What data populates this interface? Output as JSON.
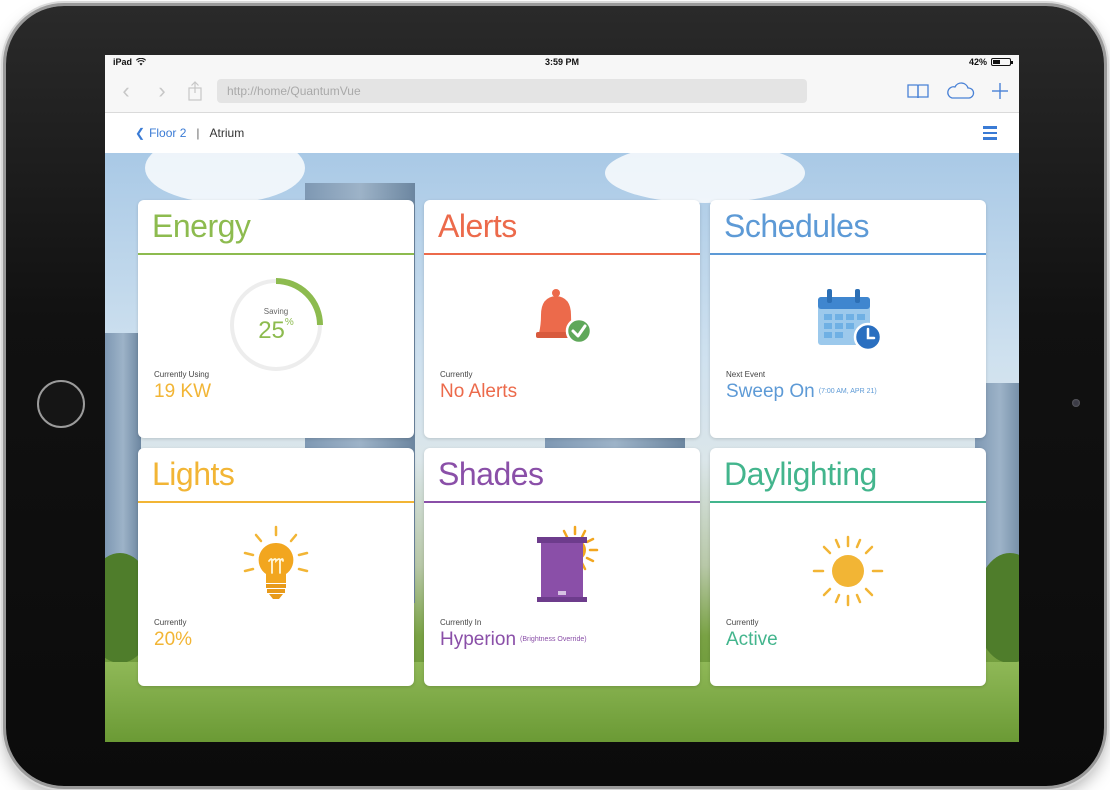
{
  "statusbar": {
    "device": "iPad",
    "time": "3:59 PM",
    "battery": "42%",
    "battery_level": 0.42
  },
  "browser": {
    "url": "http://home/QuantumVue",
    "icons": [
      "back-icon",
      "forward-icon",
      "share-icon",
      "book-icon",
      "cloud-icon",
      "plus-icon"
    ]
  },
  "breadcrumb": {
    "back_label": "Floor 2",
    "separator": "|",
    "current": "Atrium"
  },
  "colors": {
    "energy": "#8dbb4f",
    "alerts": "#ec6a4b",
    "schedules": "#5d9ad6",
    "lights": "#f2b535",
    "shades": "#8a4fa8",
    "daylighting": "#43b58d",
    "link": "#3a7bd5"
  },
  "tiles": {
    "energy": {
      "title": "Energy",
      "ring_label": "Saving",
      "ring_value": "25",
      "ring_unit": "%",
      "ring_fraction": 0.25,
      "caption": "Currently Using",
      "value": "19 KW"
    },
    "alerts": {
      "title": "Alerts",
      "icon": "bell-check-icon",
      "caption": "Currently",
      "value": "No Alerts"
    },
    "schedules": {
      "title": "Schedules",
      "icon": "calendar-clock-icon",
      "caption": "Next Event",
      "value": "Sweep On",
      "value_sub": "(7:00 AM, APR 21)"
    },
    "lights": {
      "title": "Lights",
      "icon": "lightbulb-icon",
      "caption": "Currently",
      "value": "20%"
    },
    "shades": {
      "title": "Shades",
      "icon": "shade-sun-icon",
      "caption": "Currently In",
      "value": "Hyperion",
      "value_sub": "(Brightness Override)"
    },
    "daylighting": {
      "title": "Daylighting",
      "icon": "sun-icon",
      "caption": "Currently",
      "value": "Active"
    }
  }
}
